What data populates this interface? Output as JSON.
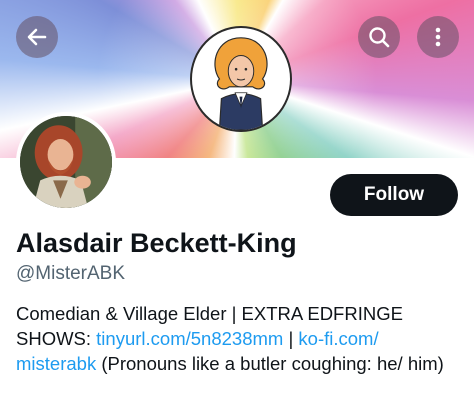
{
  "header": {
    "back_icon": "arrow-left-icon",
    "search_icon": "search-icon",
    "more_icon": "more-vertical-icon"
  },
  "banner": {
    "illustration": "cartoon portrait of a ginger-haired person in a navy suit on a rainbow sunburst background"
  },
  "profile": {
    "follow_label": "Follow",
    "display_name": "Alasdair Beckett-King",
    "handle": "@MisterABK",
    "bio": {
      "text_1": "Comedian & Village Elder | EXTRA EDFRINGE SHOWS: ",
      "link_1": "tinyurl.com/5n8238mm",
      "text_2": " | ",
      "link_2": "ko-fi.com/ misterabk",
      "text_3": " (Pronouns like a butler coughing: he/ him)"
    }
  },
  "colors": {
    "follow_bg": "#0f1419",
    "link": "#1d9bf0",
    "handle": "#536471"
  }
}
